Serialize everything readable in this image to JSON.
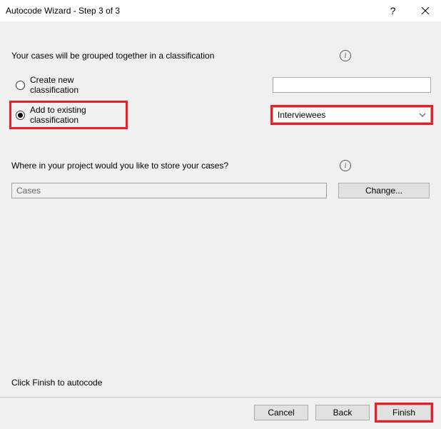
{
  "window": {
    "title": "Autocode Wizard - Step 3 of 3"
  },
  "section_classification": {
    "heading": "Your cases will be grouped together in a classification",
    "option_create": "Create new classification",
    "option_add": "Add to existing classification",
    "select_value": "Interviewees"
  },
  "section_store": {
    "heading": "Where in your project would you like to store your cases?",
    "path_value": "Cases",
    "change_label": "Change..."
  },
  "footer": {
    "hint": "Click Finish to autocode",
    "cancel": "Cancel",
    "back": "Back",
    "finish": "Finish"
  }
}
